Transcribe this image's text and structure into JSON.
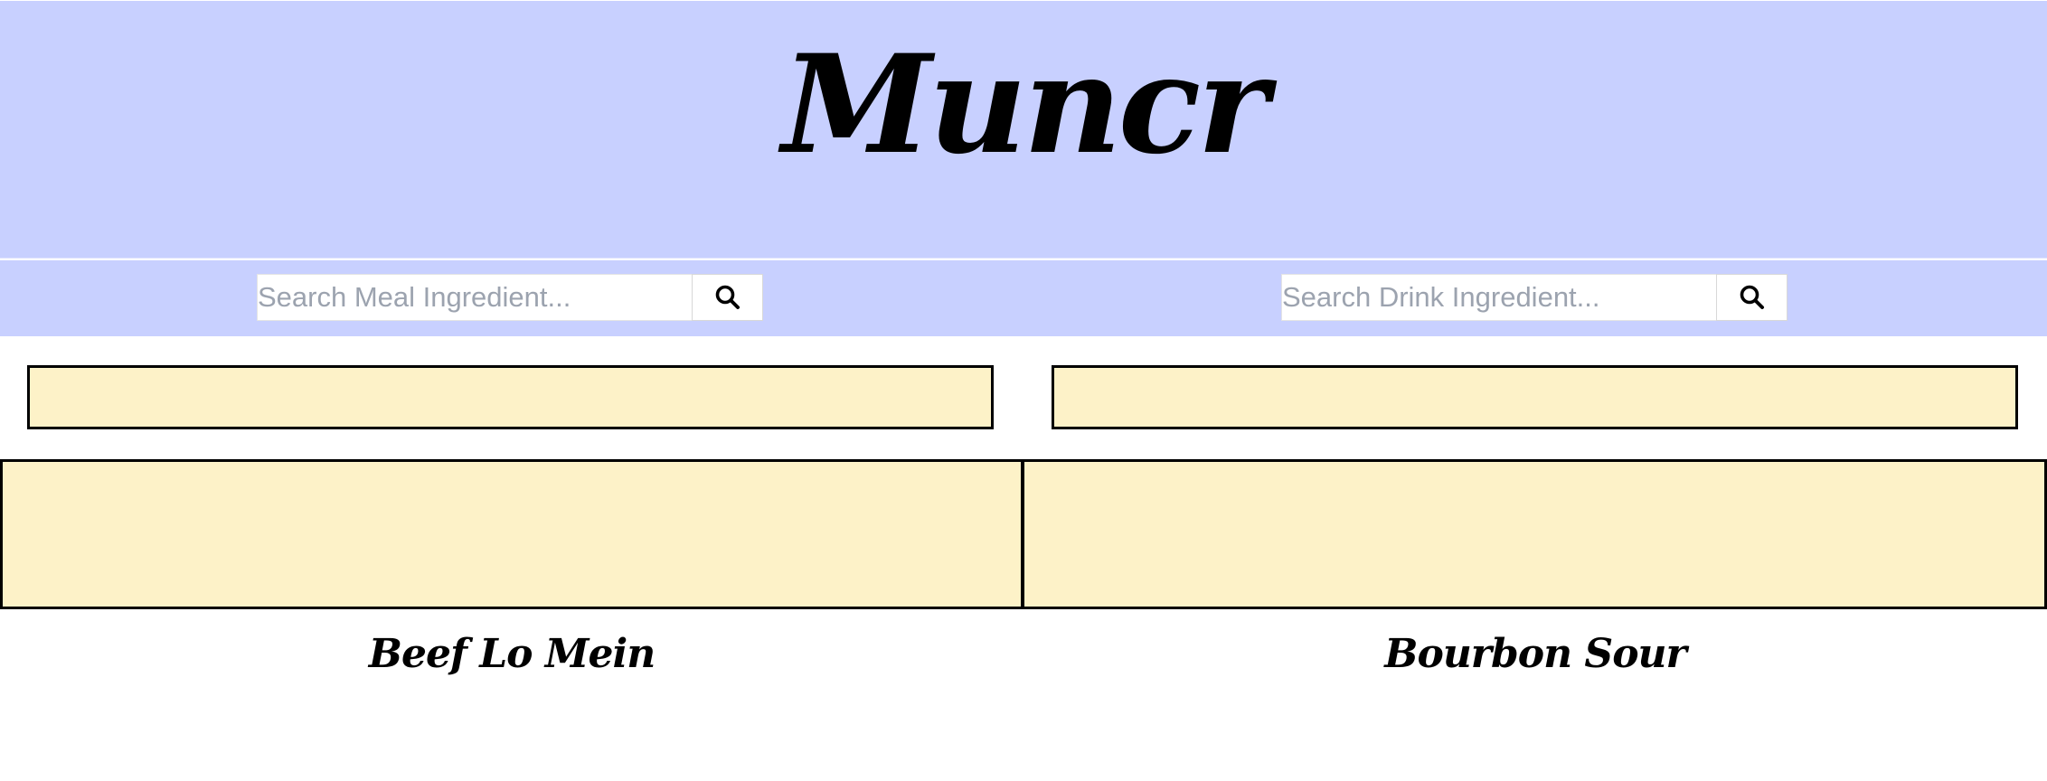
{
  "app": {
    "title": "Muncr",
    "brand_color": "#c8d0ff",
    "card_color": "#fdf2c8"
  },
  "search": {
    "meal": {
      "placeholder": "Search Meal Ingredient...",
      "value": "",
      "button_icon": "search-icon"
    },
    "drink": {
      "placeholder": "Search Drink Ingredient...",
      "value": "",
      "button_icon": "search-icon"
    }
  },
  "results": {
    "meal": {
      "title": "Beef Lo Mein"
    },
    "drink": {
      "title": "Bourbon Sour"
    }
  }
}
